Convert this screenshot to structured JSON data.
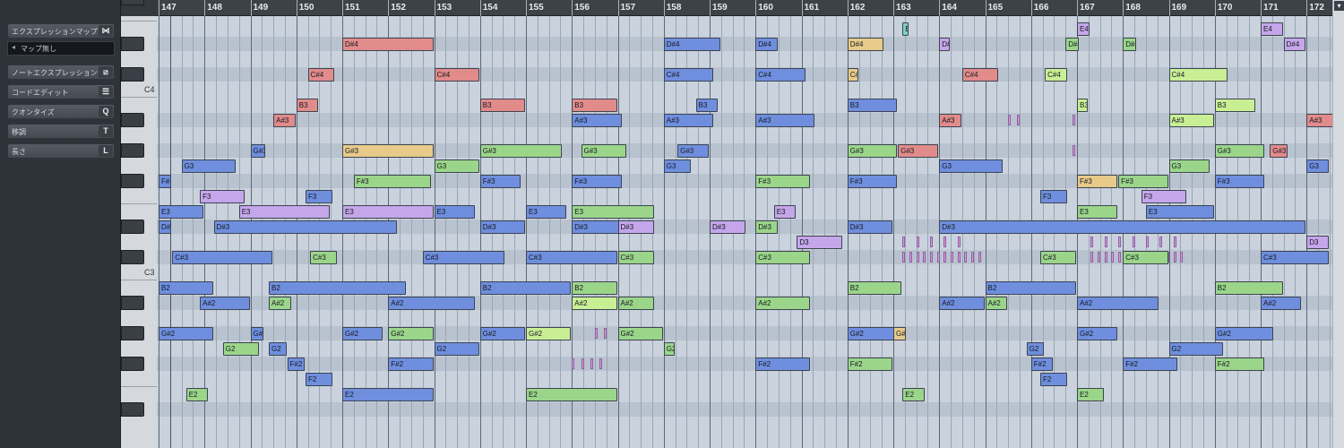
{
  "inspector": {
    "rows": [
      {
        "label": "エクスプレッションマップ",
        "icon": "⋈",
        "icon_name": "expression-map-icon"
      },
      {
        "label": "ノートエクスプレッション",
        "icon": "⧄",
        "icon_name": "note-expression-icon"
      },
      {
        "label": "コードエディット",
        "icon": "☰",
        "icon_name": "chord-edit-icon"
      },
      {
        "label": "クオンタイズ",
        "icon": "Q",
        "icon_name": "quantize-icon"
      },
      {
        "label": "移調",
        "icon": "T",
        "icon_name": "transpose-icon"
      },
      {
        "label": "長さ",
        "icon": "L",
        "icon_name": "length-icon"
      }
    ],
    "expression_map_value": "マップ無し"
  },
  "keyboard": {
    "labels": [
      "C4",
      "C3"
    ]
  },
  "ruler": {
    "bars": [
      "147",
      "148",
      "149",
      "150",
      "151",
      "152",
      "153",
      "154",
      "155",
      "156",
      "157",
      "158",
      "159",
      "160",
      "161",
      "162",
      "163",
      "164",
      "165",
      "166",
      "167",
      "168",
      "169",
      "170",
      "171",
      "172"
    ],
    "scroll_button": "▾"
  },
  "colors": {
    "blue": "#6f8ede",
    "green": "#9bd58a",
    "red": "#e18b8b",
    "purple": "#c6a6ea",
    "orange": "#e8cb8a",
    "lime": "#c9ef95",
    "teal": "#7fd0c0"
  },
  "notes": [
    {
      "pitch": "D#4",
      "bar": 151.0,
      "len": 2.0,
      "color": "red"
    },
    {
      "pitch": "D#4",
      "bar": 158.0,
      "len": 1.25,
      "color": "blue"
    },
    {
      "pitch": "D#4",
      "bar": 160.0,
      "len": 0.5,
      "color": "blue"
    },
    {
      "pitch": "D#4",
      "bar": 162.0,
      "len": 0.8,
      "color": "orange"
    },
    {
      "pitch": "D#4",
      "bar": 166.75,
      "len": 0.3,
      "color": "green"
    },
    {
      "pitch": "D#4",
      "bar": 164.0,
      "len": 0.25,
      "color": "purple"
    },
    {
      "pitch": "D#4",
      "bar": 168.0,
      "len": 0.3,
      "color": "green"
    },
    {
      "pitch": "D#4",
      "bar": 171.5,
      "len": 0.5,
      "color": "purple"
    },
    {
      "pitch": "E4",
      "bar": 167.0,
      "len": 0.3,
      "color": "purple"
    },
    {
      "pitch": "E4",
      "bar": 163.2,
      "len": 0.15,
      "color": "teal"
    },
    {
      "pitch": "E4",
      "bar": 171.0,
      "len": 0.5,
      "color": "purple"
    },
    {
      "pitch": "C#4",
      "bar": 150.25,
      "len": 0.6,
      "color": "red"
    },
    {
      "pitch": "C#4",
      "bar": 153.0,
      "len": 1.0,
      "color": "red"
    },
    {
      "pitch": "C#4",
      "bar": 158.0,
      "len": 1.1,
      "color": "blue"
    },
    {
      "pitch": "C#4",
      "bar": 160.0,
      "len": 1.1,
      "color": "blue"
    },
    {
      "pitch": "C#4",
      "bar": 162.0,
      "len": 0.25,
      "color": "orange"
    },
    {
      "pitch": "C#4",
      "bar": 164.5,
      "len": 0.8,
      "color": "red"
    },
    {
      "pitch": "C#4",
      "bar": 166.3,
      "len": 0.5,
      "color": "lime"
    },
    {
      "pitch": "C#4",
      "bar": 169.0,
      "len": 1.3,
      "color": "lime"
    },
    {
      "pitch": "B3",
      "bar": 150.0,
      "len": 0.5,
      "color": "red"
    },
    {
      "pitch": "B3",
      "bar": 154.0,
      "len": 1.0,
      "color": "red"
    },
    {
      "pitch": "B3",
      "bar": 156.0,
      "len": 1.0,
      "color": "red"
    },
    {
      "pitch": "B3",
      "bar": 158.7,
      "len": 0.5,
      "color": "blue"
    },
    {
      "pitch": "B3",
      "bar": 162.0,
      "len": 1.1,
      "color": "blue"
    },
    {
      "pitch": "B3",
      "bar": 167.0,
      "len": 0.25,
      "color": "lime"
    },
    {
      "pitch": "B3",
      "bar": 170.0,
      "len": 0.9,
      "color": "lime"
    },
    {
      "pitch": "A#3",
      "bar": 149.5,
      "len": 0.5,
      "color": "red"
    },
    {
      "pitch": "A#3",
      "bar": 156.0,
      "len": 1.1,
      "color": "blue"
    },
    {
      "pitch": "A#3",
      "bar": 158.0,
      "len": 1.1,
      "color": "blue"
    },
    {
      "pitch": "A#3",
      "bar": 160.0,
      "len": 1.3,
      "color": "blue"
    },
    {
      "pitch": "A#3",
      "bar": 164.0,
      "len": 0.5,
      "color": "red"
    },
    {
      "pitch": "A#3",
      "bar": 169.0,
      "len": 1.0,
      "color": "lime"
    },
    {
      "pitch": "A#3",
      "bar": 172.0,
      "len": 1.0,
      "color": "red"
    },
    {
      "pitch": "G#3",
      "bar": 149.0,
      "len": 0.35,
      "color": "blue"
    },
    {
      "pitch": "G#3",
      "bar": 151.0,
      "len": 2.0,
      "color": "orange"
    },
    {
      "pitch": "G#3",
      "bar": 154.0,
      "len": 1.8,
      "color": "green"
    },
    {
      "pitch": "G#3",
      "bar": 156.2,
      "len": 1.0,
      "color": "green"
    },
    {
      "pitch": "G#3",
      "bar": 158.3,
      "len": 0.7,
      "color": "blue"
    },
    {
      "pitch": "G#3",
      "bar": 162.0,
      "len": 1.1,
      "color": "green"
    },
    {
      "pitch": "G#3",
      "bar": 163.1,
      "len": 0.9,
      "color": "red"
    },
    {
      "pitch": "G#3",
      "bar": 170.0,
      "len": 1.1,
      "color": "green"
    },
    {
      "pitch": "G#3",
      "bar": 171.2,
      "len": 0.4,
      "color": "red"
    },
    {
      "pitch": "G3",
      "bar": 147.5,
      "len": 1.2,
      "color": "blue"
    },
    {
      "pitch": "G3",
      "bar": 153.0,
      "len": 1.0,
      "color": "green"
    },
    {
      "pitch": "G3",
      "bar": 158.0,
      "len": 0.6,
      "color": "blue"
    },
    {
      "pitch": "G3",
      "bar": 164.0,
      "len": 1.4,
      "color": "blue"
    },
    {
      "pitch": "G3",
      "bar": 169.0,
      "len": 0.9,
      "color": "green"
    },
    {
      "pitch": "G3",
      "bar": 172.0,
      "len": 0.5,
      "color": "blue"
    },
    {
      "pitch": "F#3",
      "bar": 147.0,
      "len": 0.3,
      "color": "blue"
    },
    {
      "pitch": "F#3",
      "bar": 151.25,
      "len": 1.7,
      "color": "green"
    },
    {
      "pitch": "F#3",
      "bar": 154.0,
      "len": 0.9,
      "color": "blue"
    },
    {
      "pitch": "F#3",
      "bar": 156.0,
      "len": 1.1,
      "color": "blue"
    },
    {
      "pitch": "F#3",
      "bar": 160.0,
      "len": 1.2,
      "color": "green"
    },
    {
      "pitch": "F#3",
      "bar": 162.0,
      "len": 1.1,
      "color": "blue"
    },
    {
      "pitch": "F#3",
      "bar": 167.0,
      "len": 0.9,
      "color": "orange"
    },
    {
      "pitch": "F#3",
      "bar": 167.9,
      "len": 1.1,
      "color": "green"
    },
    {
      "pitch": "F#3",
      "bar": 170.0,
      "len": 1.1,
      "color": "blue"
    },
    {
      "pitch": "F3",
      "bar": 147.9,
      "len": 1.0,
      "color": "purple"
    },
    {
      "pitch": "F3",
      "bar": 150.2,
      "len": 0.6,
      "color": "blue"
    },
    {
      "pitch": "F3",
      "bar": 166.2,
      "len": 0.6,
      "color": "blue"
    },
    {
      "pitch": "F3",
      "bar": 168.4,
      "len": 1.0,
      "color": "purple"
    },
    {
      "pitch": "E3",
      "bar": 147.0,
      "len": 1.0,
      "color": "blue"
    },
    {
      "pitch": "E3",
      "bar": 148.75,
      "len": 2.0,
      "color": "purple"
    },
    {
      "pitch": "E3",
      "bar": 151.0,
      "len": 2.0,
      "color": "purple"
    },
    {
      "pitch": "E3",
      "bar": 153.0,
      "len": 0.9,
      "color": "blue"
    },
    {
      "pitch": "E3",
      "bar": 155.0,
      "len": 0.9,
      "color": "blue"
    },
    {
      "pitch": "E3",
      "bar": 156.0,
      "len": 1.8,
      "color": "green"
    },
    {
      "pitch": "E3",
      "bar": 160.4,
      "len": 0.5,
      "color": "purple"
    },
    {
      "pitch": "E3",
      "bar": 167.0,
      "len": 0.9,
      "color": "green"
    },
    {
      "pitch": "E3",
      "bar": 168.5,
      "len": 1.5,
      "color": "blue"
    },
    {
      "pitch": "D#3",
      "bar": 147.0,
      "len": 0.3,
      "color": "blue"
    },
    {
      "pitch": "D#3",
      "bar": 148.2,
      "len": 4.0,
      "color": "blue"
    },
    {
      "pitch": "D#3",
      "bar": 154.0,
      "len": 1.0,
      "color": "blue"
    },
    {
      "pitch": "D#3",
      "bar": 156.0,
      "len": 1.8,
      "color": "blue"
    },
    {
      "pitch": "D#3",
      "bar": 157.0,
      "len": 0.8,
      "color": "purple"
    },
    {
      "pitch": "D#3",
      "bar": 159.0,
      "len": 0.8,
      "color": "purple"
    },
    {
      "pitch": "D#3",
      "bar": 160.0,
      "len": 0.5,
      "color": "green"
    },
    {
      "pitch": "D#3",
      "bar": 162.0,
      "len": 1.0,
      "color": "blue"
    },
    {
      "pitch": "D#3",
      "bar": 164.0,
      "len": 8.0,
      "color": "blue"
    },
    {
      "pitch": "D3",
      "bar": 160.9,
      "len": 1.0,
      "color": "purple"
    },
    {
      "pitch": "D3",
      "bar": 172.0,
      "len": 0.5,
      "color": "purple"
    },
    {
      "pitch": "C#3",
      "bar": 147.3,
      "len": 2.2,
      "color": "blue"
    },
    {
      "pitch": "C#3",
      "bar": 150.3,
      "len": 0.6,
      "color": "green"
    },
    {
      "pitch": "C#3",
      "bar": 152.75,
      "len": 1.8,
      "color": "blue"
    },
    {
      "pitch": "C#3",
      "bar": 155.0,
      "len": 2.0,
      "color": "blue"
    },
    {
      "pitch": "C#3",
      "bar": 157.0,
      "len": 0.8,
      "color": "green"
    },
    {
      "pitch": "C#3",
      "bar": 160.0,
      "len": 1.2,
      "color": "green"
    },
    {
      "pitch": "C#3",
      "bar": 166.2,
      "len": 0.8,
      "color": "green"
    },
    {
      "pitch": "C#3",
      "bar": 168.0,
      "len": 1.0,
      "color": "green"
    },
    {
      "pitch": "C#3",
      "bar": 171.0,
      "len": 1.5,
      "color": "blue"
    },
    {
      "pitch": "B2",
      "bar": 147.0,
      "len": 1.2,
      "color": "blue"
    },
    {
      "pitch": "B2",
      "bar": 149.4,
      "len": 3.0,
      "color": "blue"
    },
    {
      "pitch": "B2",
      "bar": 154.0,
      "len": 2.0,
      "color": "blue"
    },
    {
      "pitch": "B2",
      "bar": 156.0,
      "len": 1.0,
      "color": "green"
    },
    {
      "pitch": "B2",
      "bar": 162.0,
      "len": 1.2,
      "color": "green"
    },
    {
      "pitch": "B2",
      "bar": 165.0,
      "len": 2.0,
      "color": "blue"
    },
    {
      "pitch": "B2",
      "bar": 170.0,
      "len": 1.5,
      "color": "green"
    },
    {
      "pitch": "A#2",
      "bar": 147.9,
      "len": 1.1,
      "color": "blue"
    },
    {
      "pitch": "A#2",
      "bar": 149.4,
      "len": 0.5,
      "color": "green"
    },
    {
      "pitch": "A#2",
      "bar": 152.0,
      "len": 1.9,
      "color": "blue"
    },
    {
      "pitch": "A#2",
      "bar": 156.0,
      "len": 1.0,
      "color": "lime"
    },
    {
      "pitch": "A#2",
      "bar": 157.0,
      "len": 0.8,
      "color": "green"
    },
    {
      "pitch": "A#2",
      "bar": 160.0,
      "len": 1.2,
      "color": "green"
    },
    {
      "pitch": "A#2",
      "bar": 164.0,
      "len": 1.0,
      "color": "blue"
    },
    {
      "pitch": "A#2",
      "bar": 165.0,
      "len": 0.5,
      "color": "green"
    },
    {
      "pitch": "A#2",
      "bar": 167.0,
      "len": 1.8,
      "color": "blue"
    },
    {
      "pitch": "A#2",
      "bar": 171.0,
      "len": 0.9,
      "color": "blue"
    },
    {
      "pitch": "G#2",
      "bar": 147.0,
      "len": 1.2,
      "color": "blue"
    },
    {
      "pitch": "G#2",
      "bar": 149.0,
      "len": 0.3,
      "color": "blue"
    },
    {
      "pitch": "G#2",
      "bar": 151.0,
      "len": 0.9,
      "color": "blue"
    },
    {
      "pitch": "G#2",
      "bar": 152.0,
      "len": 1.0,
      "color": "green"
    },
    {
      "pitch": "G#2",
      "bar": 154.0,
      "len": 1.0,
      "color": "blue"
    },
    {
      "pitch": "G#2",
      "bar": 155.0,
      "len": 1.0,
      "color": "lime"
    },
    {
      "pitch": "G#2",
      "bar": 157.0,
      "len": 1.0,
      "color": "green"
    },
    {
      "pitch": "G#2",
      "bar": 162.0,
      "len": 1.2,
      "color": "blue"
    },
    {
      "pitch": "G#2",
      "bar": 163.0,
      "len": 0.3,
      "color": "orange"
    },
    {
      "pitch": "G#2",
      "bar": 167.0,
      "len": 0.9,
      "color": "blue"
    },
    {
      "pitch": "G#2",
      "bar": 170.0,
      "len": 1.3,
      "color": "blue"
    },
    {
      "pitch": "G2",
      "bar": 148.4,
      "len": 0.8,
      "color": "green"
    },
    {
      "pitch": "G2",
      "bar": 149.4,
      "len": 0.4,
      "color": "blue"
    },
    {
      "pitch": "G2",
      "bar": 153.0,
      "len": 1.0,
      "color": "blue"
    },
    {
      "pitch": "G2",
      "bar": 158.0,
      "len": 0.25,
      "color": "green"
    },
    {
      "pitch": "G2",
      "bar": 165.9,
      "len": 0.4,
      "color": "blue"
    },
    {
      "pitch": "G2",
      "bar": 169.0,
      "len": 1.2,
      "color": "blue"
    },
    {
      "pitch": "F#2",
      "bar": 149.8,
      "len": 0.4,
      "color": "blue"
    },
    {
      "pitch": "F#2",
      "bar": 152.0,
      "len": 1.0,
      "color": "blue"
    },
    {
      "pitch": "F#2",
      "bar": 160.0,
      "len": 1.2,
      "color": "blue"
    },
    {
      "pitch": "F#2",
      "bar": 162.0,
      "len": 1.0,
      "color": "green"
    },
    {
      "pitch": "F#2",
      "bar": 166.0,
      "len": 0.5,
      "color": "blue"
    },
    {
      "pitch": "F#2",
      "bar": 168.0,
      "len": 1.2,
      "color": "blue"
    },
    {
      "pitch": "F#2",
      "bar": 170.0,
      "len": 1.1,
      "color": "green"
    },
    {
      "pitch": "F2",
      "bar": 150.2,
      "len": 0.6,
      "color": "blue"
    },
    {
      "pitch": "F2",
      "bar": 166.2,
      "len": 0.6,
      "color": "blue"
    },
    {
      "pitch": "E2",
      "bar": 147.6,
      "len": 0.5,
      "color": "green"
    },
    {
      "pitch": "E2",
      "bar": 151.0,
      "len": 2.0,
      "color": "blue"
    },
    {
      "pitch": "E2",
      "bar": 155.0,
      "len": 2.0,
      "color": "green"
    },
    {
      "pitch": "E2",
      "bar": 163.2,
      "len": 0.5,
      "color": "green"
    },
    {
      "pitch": "E2",
      "bar": 167.0,
      "len": 0.6,
      "color": "green"
    }
  ]
}
